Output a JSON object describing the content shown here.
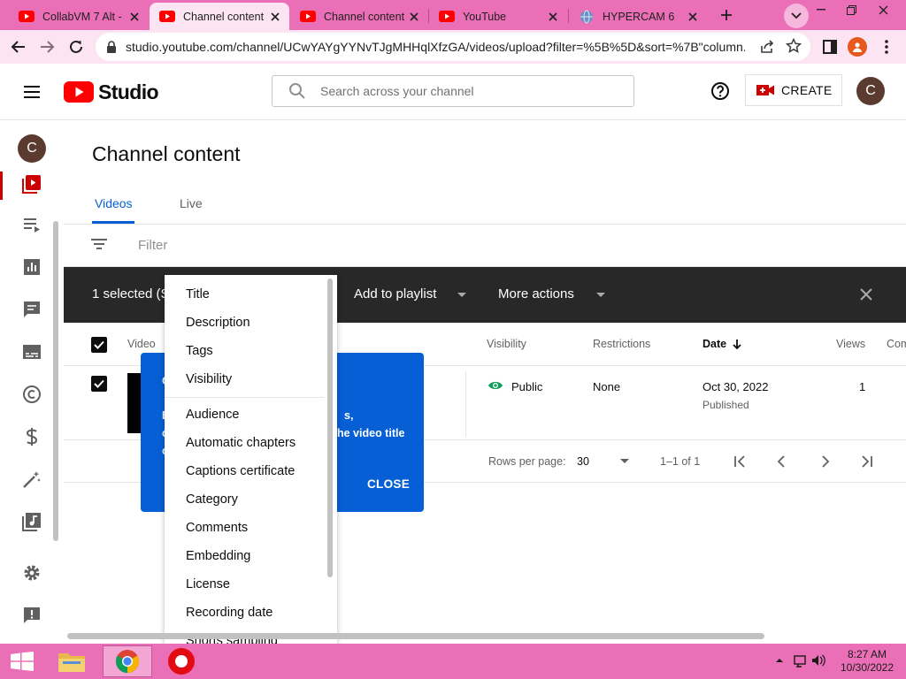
{
  "browser": {
    "tabs": [
      {
        "title": "CollabVM 7 Alt -",
        "favicon": "youtube-favicon",
        "active": false
      },
      {
        "title": "Channel content",
        "favicon": "youtube-studio-favicon",
        "active": true
      },
      {
        "title": "Channel content",
        "favicon": "youtube-studio-favicon",
        "active": false
      },
      {
        "title": "YouTube",
        "favicon": "youtube-favicon",
        "active": false
      },
      {
        "title": "HYPERCAM 6",
        "favicon": "globe-favicon",
        "active": false
      }
    ],
    "url": "studio.youtube.com/channel/UCwYAYgYYNvTJgMHHqlXfzGA/videos/upload?filter=%5B%5D&sort=%7B\"column...",
    "profile_initial": "C"
  },
  "header": {
    "logo_text": "Studio",
    "search_placeholder": "Search across your channel",
    "create_label": "CREATE",
    "avatar_initial": "C"
  },
  "sidebar": {
    "avatar_initial": "C",
    "items": [
      "content-icon",
      "playlists-icon",
      "analytics-icon",
      "comments-icon",
      "subtitles-icon",
      "copyright-icon",
      "earn-icon",
      "customization-icon",
      "audio-library-icon",
      "settings-icon",
      "feedback-icon"
    ]
  },
  "page": {
    "title": "Channel content",
    "tabs": [
      "Videos",
      "Live"
    ],
    "filter_placeholder": "Filter"
  },
  "selection_bar": {
    "selected_text": "1 selected (S",
    "add_to_playlist": "Add to playlist",
    "more_actions": "More actions"
  },
  "table": {
    "headers": {
      "video": "Video",
      "visibility": "Visibility",
      "restrictions": "Restrictions",
      "date": "Date",
      "views": "Views",
      "comments": "Com"
    },
    "rows": [
      {
        "visibility": "Public",
        "restrictions": "None",
        "date": "Oct 30, 2022",
        "date_status": "Published",
        "views": "1"
      }
    ]
  },
  "pagination": {
    "rows_per_page_label": "Rows per page:",
    "rows_per_page_value": "30",
    "range": "1–1 of 1"
  },
  "tooltip": {
    "title": "C",
    "line1_left": "E",
    "line1_right": "s,",
    "line2_left": "c",
    "line2_right": "he video title",
    "line3_left": "c",
    "close_label": "CLOSE"
  },
  "column_menu": {
    "items_group1": [
      "Title",
      "Description",
      "Tags",
      "Visibility"
    ],
    "items_group2": [
      "Audience",
      "Automatic chapters",
      "Captions certificate",
      "Category",
      "Comments",
      "Embedding",
      "License",
      "Recording date",
      "Shorts sampling"
    ]
  },
  "taskbar": {
    "time": "8:27 AM",
    "date": "10/30/2022"
  },
  "colors": {
    "accent_blue": "#065fd4",
    "youtube_red": "#ff0000",
    "tabstrip_pink": "#eb6fb7",
    "selection_bar": "#282828",
    "public_green": "#0f9d58"
  }
}
